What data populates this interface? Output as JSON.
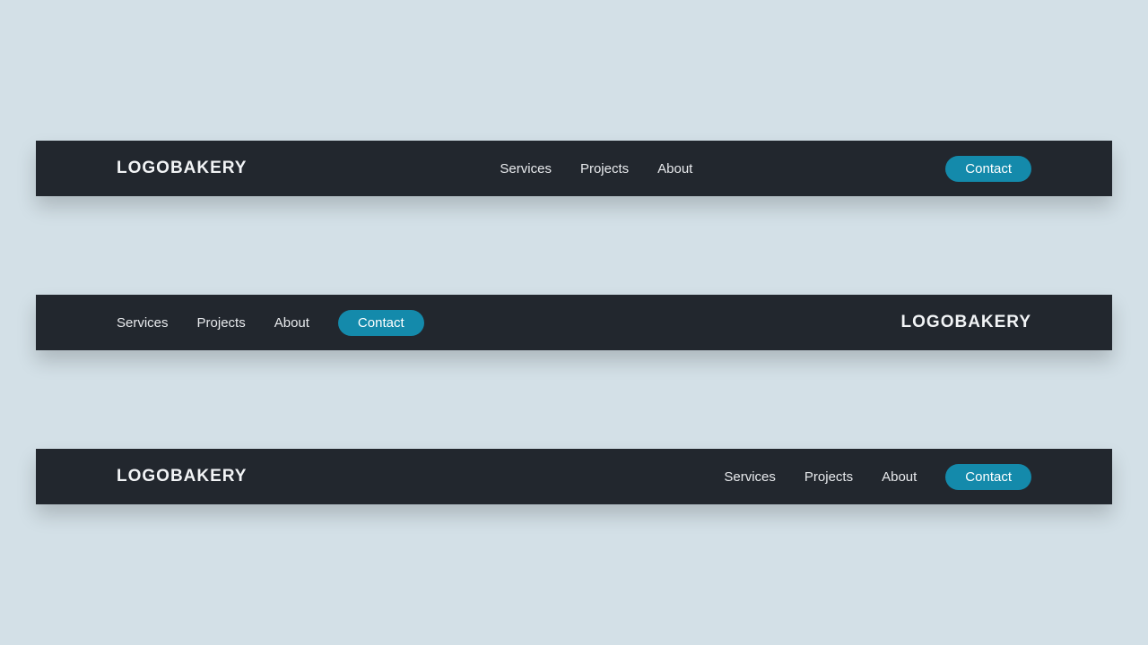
{
  "brand": "LOGOBAKERY",
  "nav": {
    "items": [
      "Services",
      "Projects",
      "About"
    ],
    "cta": "Contact"
  },
  "colors": {
    "background": "#d3e0e7",
    "navbar_bg": "#22272e",
    "text": "#ffffff",
    "accent": "#148aab"
  }
}
